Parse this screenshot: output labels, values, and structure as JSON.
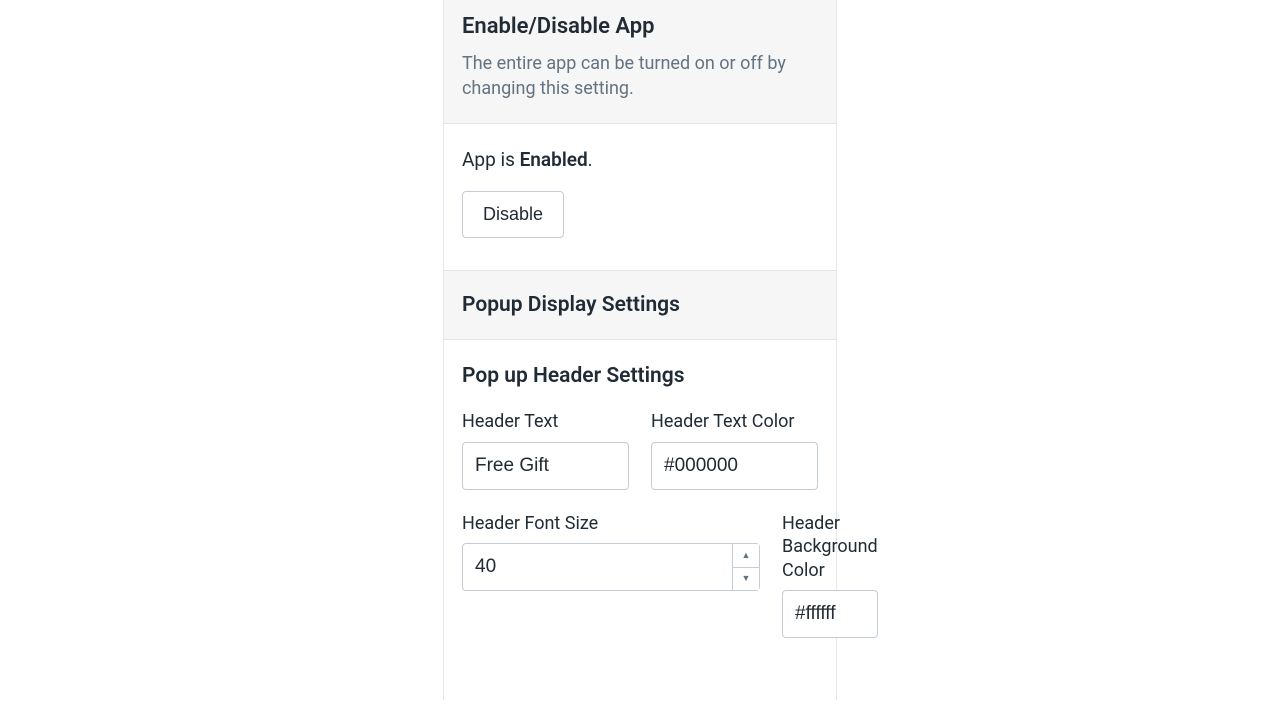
{
  "enable_section": {
    "title": "Enable/Disable App",
    "description": "The entire app can be turned on or off by changing this setting.",
    "status_prefix": "App is ",
    "status_value": "Enabled",
    "status_suffix": ".",
    "button_label": "Disable"
  },
  "popup_section": {
    "title": "Popup Display Settings"
  },
  "header_settings": {
    "title": "Pop up Header Settings",
    "header_text": {
      "label": "Header Text",
      "value": "Free Gift"
    },
    "header_text_color": {
      "label": "Header Text Color",
      "value": "#000000"
    },
    "header_font_size": {
      "label": "Header Font Size",
      "value": "40"
    },
    "header_bg_color": {
      "label": "Header Background Color",
      "value": "#ffffff"
    }
  }
}
